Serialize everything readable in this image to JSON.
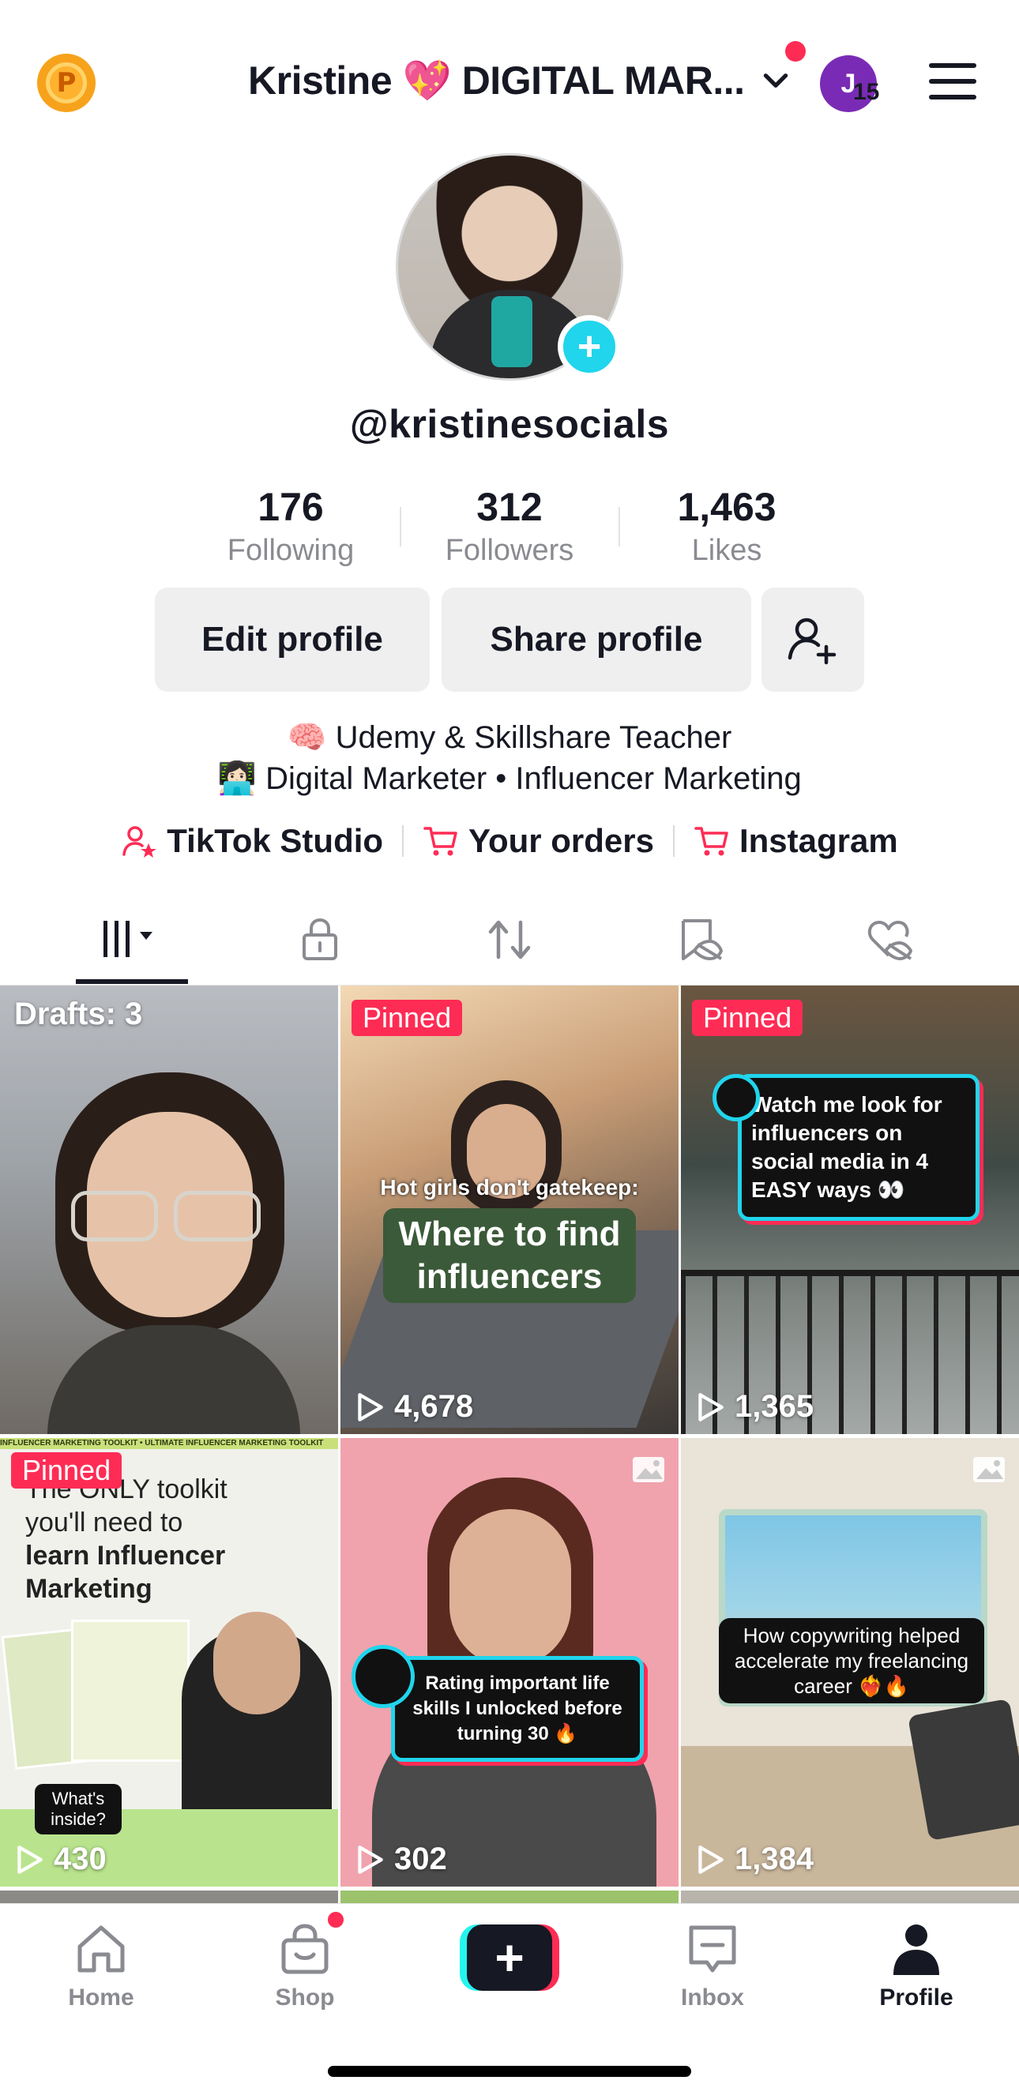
{
  "header": {
    "points_badge_letter": "P",
    "account_name": "Kristine 💖 DIGITAL MAR...",
    "switch_avatar_letter": "J",
    "switch_count": "15"
  },
  "profile": {
    "username": "@kristinesocials",
    "avatar_add": "+",
    "stats": [
      {
        "value": "176",
        "label": "Following"
      },
      {
        "value": "312",
        "label": "Followers"
      },
      {
        "value": "1,463",
        "label": "Likes"
      }
    ],
    "edit_profile_label": "Edit profile",
    "share_profile_label": "Share profile",
    "bio_line1": "🧠 Udemy & Skillshare Teacher",
    "bio_line2": "👩🏻‍💻 Digital Marketer • Influencer Marketing",
    "links": [
      {
        "label": "TikTok Studio",
        "icon": "tiktok-studio-icon"
      },
      {
        "label": "Your orders",
        "icon": "cart-icon"
      },
      {
        "label": "Instagram",
        "icon": "cart-icon"
      }
    ]
  },
  "tabs": [
    {
      "name": "videos",
      "icon": "grid-dropdown-icon",
      "active": true
    },
    {
      "name": "private",
      "icon": "lock-icon"
    },
    {
      "name": "reposts",
      "icon": "repost-icon"
    },
    {
      "name": "favorites",
      "icon": "bookmark-eye-icon"
    },
    {
      "name": "liked",
      "icon": "heart-eye-icon"
    }
  ],
  "grid": {
    "drafts_label": "Drafts: 3",
    "pinned_label": "Pinned",
    "tiles": [
      {
        "views": "4,678",
        "caption_top": "Hot girls don't gatekeep:",
        "caption_main": "Where to find influencers"
      },
      {
        "views": "1,365",
        "caption_main": "Watch me look for influencers on social media in 4 EASY ways 👀"
      },
      {
        "views": "430",
        "caption_banner": "INFLUENCER MARKETING TOOLKIT • ULTIMATE INFLUENCER MARKETING TOOLKIT",
        "caption_line1": "The ONLY toolkit",
        "caption_line2": "you'll need to",
        "caption_line3": "learn Influencer",
        "caption_line4": "Marketing",
        "caption_small": "What's inside?"
      },
      {
        "views": "302",
        "caption_main": "Rating important life skills I unlocked before turning 30 🔥"
      },
      {
        "views": "1,384",
        "caption_main": "How copywriting helped accelerate my freelancing career ❤️‍🔥🔥"
      }
    ]
  },
  "bottom_nav": {
    "items": [
      {
        "label": "Home",
        "icon": "home-icon"
      },
      {
        "label": "Shop",
        "icon": "shop-icon"
      },
      {
        "label": "",
        "icon": "create-plus-icon"
      },
      {
        "label": "Inbox",
        "icon": "inbox-icon"
      },
      {
        "label": "Profile",
        "icon": "profile-icon",
        "active": true
      }
    ],
    "create_plus": "+"
  },
  "colors": {
    "accent_red": "#fe2c55",
    "accent_cyan": "#20d5ec",
    "text_primary": "#161823",
    "text_secondary": "#8a8b91",
    "button_bg": "#efeff0"
  }
}
